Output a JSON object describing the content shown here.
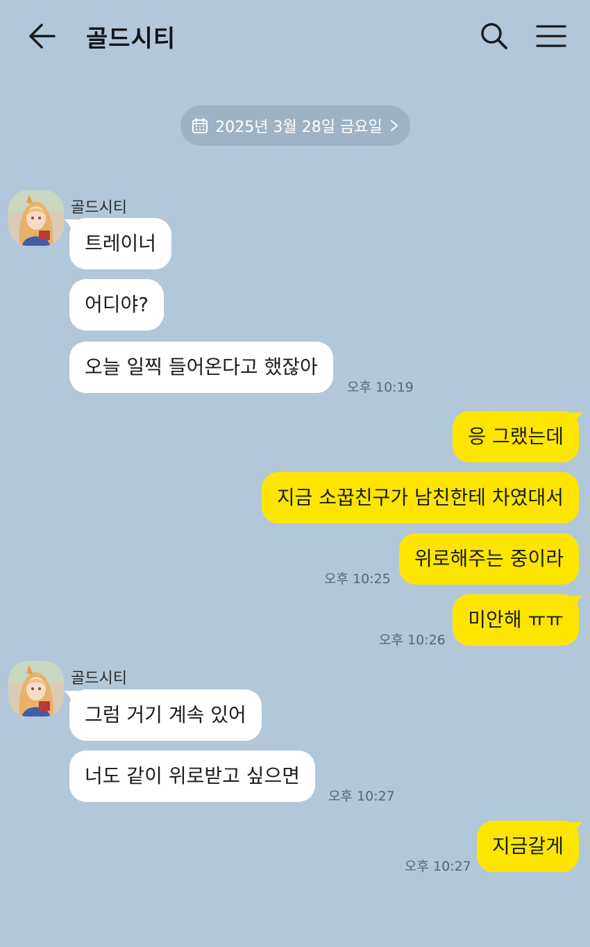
{
  "header": {
    "title": "골드시티"
  },
  "date_divider": {
    "label": "2025년 3월 28일 금요일"
  },
  "colors": {
    "background": "#b2c7da",
    "incoming_bubble": "#ffffff",
    "outgoing_bubble": "#fee500",
    "date_pill": "#9fb3c6"
  },
  "messages": {
    "group1": {
      "sender": "골드시티",
      "m1": "트레이너",
      "m2": "어디야?",
      "m3": "오늘 일찍 들어온다고 했잖아",
      "time": "오후 10:19"
    },
    "out1": {
      "m1": "응 그랬는데",
      "m2": "지금 소꿉친구가 남친한테 차였대서",
      "m3": "위로해주는 중이라",
      "time1": "오후 10:25",
      "m4": "미안해 ㅠㅠ",
      "time2": "오후 10:26"
    },
    "group2": {
      "sender": "골드시티",
      "m1": "그럼 거기 계속 있어",
      "m2": "너도 같이 위로받고 싶으면",
      "time": "오후 10:27"
    },
    "out2": {
      "m1": "지금갈게",
      "time": "오후 10:27"
    }
  }
}
